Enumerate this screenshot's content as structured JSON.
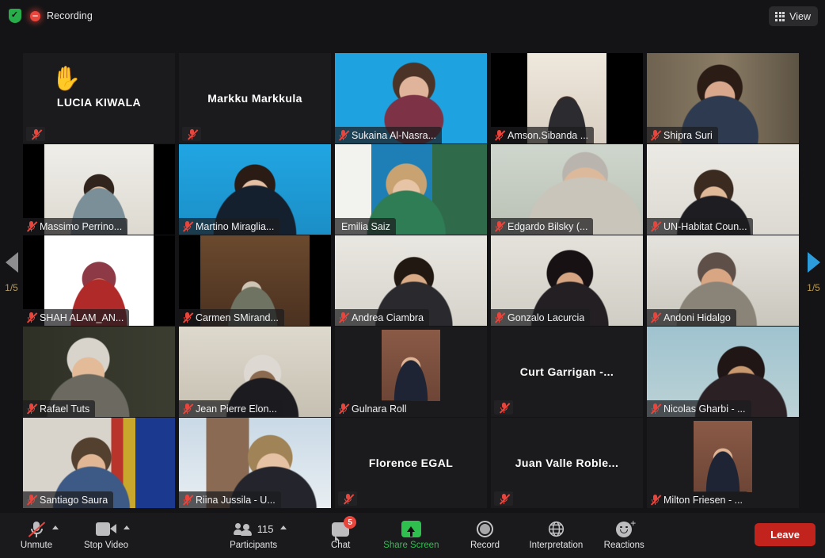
{
  "topbar": {
    "encryption_icon": "shield-check-icon",
    "recording_label": "Recording",
    "view_label": "View",
    "view_icon": "grid-icon"
  },
  "gallery": {
    "page_indicator_left": "1/5",
    "page_indicator_right": "1/5",
    "prev_arrow_color": "#8d8d90",
    "next_arrow_color": "#2d9cdb",
    "active_speaker_border": "#cddc1f",
    "muted_icon_color": "#e8453c",
    "participants": [
      {
        "name": "LUCIA KIWALA",
        "video": false,
        "muted": true,
        "hand_raised": true,
        "active": false,
        "avatar": false
      },
      {
        "name": "Markku Markkula",
        "video": false,
        "muted": true,
        "hand_raised": false,
        "active": false,
        "avatar": false
      },
      {
        "name": "Sukaina Al-Nasra...",
        "video": true,
        "muted": true,
        "hand_raised": false,
        "active": false,
        "avatar": false
      },
      {
        "name": "Amson.Sibanda ...",
        "video": true,
        "muted": true,
        "hand_raised": false,
        "active": false,
        "avatar": false
      },
      {
        "name": "Shipra Suri",
        "video": true,
        "muted": true,
        "hand_raised": false,
        "active": false,
        "avatar": false
      },
      {
        "name": "Massimo Perrino...",
        "video": true,
        "muted": true,
        "hand_raised": false,
        "active": false,
        "avatar": false
      },
      {
        "name": "Martino Miraglia...",
        "video": true,
        "muted": true,
        "hand_raised": false,
        "active": false,
        "avatar": false
      },
      {
        "name": "Emilia Saiz",
        "video": true,
        "muted": false,
        "hand_raised": false,
        "active": true,
        "avatar": false
      },
      {
        "name": "Edgardo Bilsky (...",
        "video": true,
        "muted": true,
        "hand_raised": false,
        "active": false,
        "avatar": false
      },
      {
        "name": "UN-Habitat Coun...",
        "video": true,
        "muted": true,
        "hand_raised": false,
        "active": false,
        "avatar": false
      },
      {
        "name": "SHAH ALAM_AN...",
        "video": true,
        "muted": true,
        "hand_raised": false,
        "active": false,
        "avatar": false
      },
      {
        "name": "Carmen SMirand...",
        "video": true,
        "muted": true,
        "hand_raised": false,
        "active": false,
        "avatar": false
      },
      {
        "name": "Andrea Ciambra",
        "video": true,
        "muted": true,
        "hand_raised": false,
        "active": false,
        "avatar": false
      },
      {
        "name": "Gonzalo Lacurcia",
        "video": true,
        "muted": true,
        "hand_raised": false,
        "active": false,
        "avatar": false
      },
      {
        "name": "Andoni Hidalgo",
        "video": true,
        "muted": true,
        "hand_raised": false,
        "active": false,
        "avatar": false
      },
      {
        "name": "Rafael Tuts",
        "video": true,
        "muted": true,
        "hand_raised": false,
        "active": false,
        "avatar": false
      },
      {
        "name": "Jean Pierre Elon...",
        "video": true,
        "muted": true,
        "hand_raised": false,
        "active": false,
        "avatar": false
      },
      {
        "name": "Gulnara Roll",
        "video": true,
        "muted": true,
        "hand_raised": false,
        "active": false,
        "avatar": true
      },
      {
        "name": "Curt Garrigan  -...",
        "video": false,
        "muted": true,
        "hand_raised": false,
        "active": false,
        "avatar": false
      },
      {
        "name": "Nicolas Gharbi - ...",
        "video": true,
        "muted": true,
        "hand_raised": false,
        "active": false,
        "avatar": false
      },
      {
        "name": "Santiago Saura",
        "video": true,
        "muted": true,
        "hand_raised": false,
        "active": false,
        "avatar": false
      },
      {
        "name": "Riina Jussila - U...",
        "video": true,
        "muted": true,
        "hand_raised": false,
        "active": false,
        "avatar": false
      },
      {
        "name": "Florence EGAL",
        "video": false,
        "muted": true,
        "hand_raised": false,
        "active": false,
        "avatar": false
      },
      {
        "name": "Juan Valle Roble...",
        "video": false,
        "muted": true,
        "hand_raised": false,
        "active": false,
        "avatar": false
      },
      {
        "name": "Milton Friesen - ...",
        "video": true,
        "muted": true,
        "hand_raised": false,
        "active": false,
        "avatar": true
      }
    ]
  },
  "toolbar": {
    "mute_label": "Unmute",
    "mute_icon": "microphone-muted-icon",
    "video_label": "Stop Video",
    "video_icon": "camera-icon",
    "participants_label": "Participants",
    "participants_count": "115",
    "participants_icon": "people-icon",
    "chat_label": "Chat",
    "chat_icon": "chat-bubble-icon",
    "chat_badge": "5",
    "share_label": "Share Screen",
    "share_icon": "share-screen-icon",
    "record_label": "Record",
    "record_icon": "record-circle-icon",
    "interpretation_label": "Interpretation",
    "interpretation_icon": "globe-icon",
    "reactions_label": "Reactions",
    "reactions_icon": "smiley-plus-icon",
    "leave_label": "Leave"
  }
}
